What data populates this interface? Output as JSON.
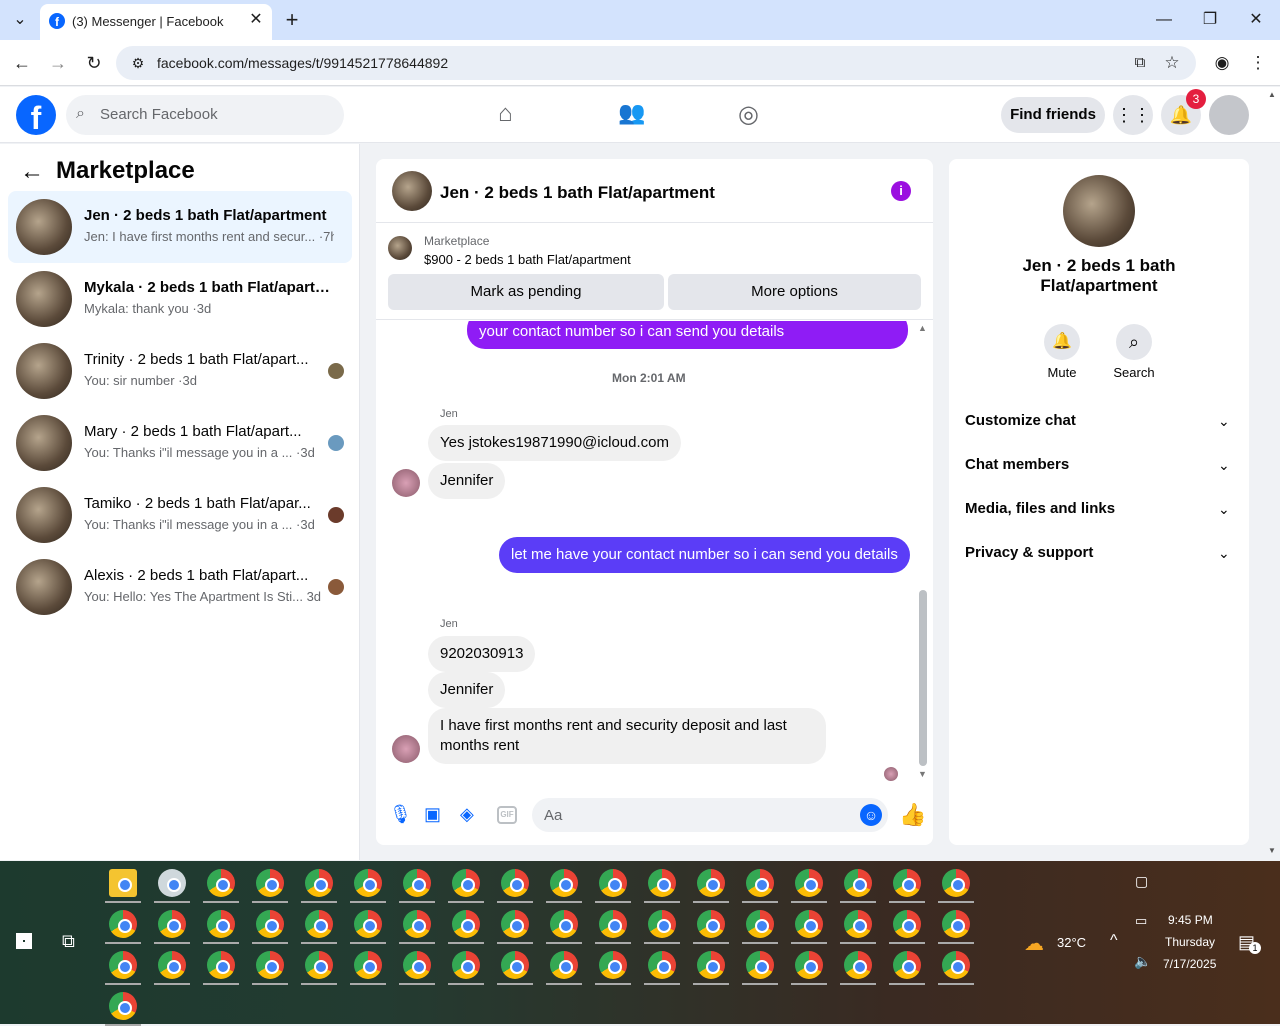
{
  "browser": {
    "tab_title": "(3) Messenger | Facebook",
    "url": "facebook.com/messages/t/9914521778644892",
    "icons": [
      "tab-search-icon",
      "facebook-favicon",
      "close-tab-icon",
      "new-tab-icon",
      "minimize-icon",
      "restore-icon",
      "close-window-icon",
      "back-icon",
      "forward-icon",
      "reload-icon",
      "site-info-icon",
      "install-app-icon",
      "bookmark-star-icon",
      "profile-icon",
      "menu-kebab-icon"
    ]
  },
  "fb_header": {
    "logo": "f",
    "search_placeholder": "Search Facebook",
    "find_friends": "Find friends",
    "notification_count": "3"
  },
  "sidebar": {
    "title": "Marketplace",
    "conversations": [
      {
        "title": "Jen · 2 beds 1 bath Flat/apartment",
        "preview": "Jen: I have first months rent and secur... ·7h",
        "active": true
      },
      {
        "title": "Mykala · 2 beds 1 bath Flat/apartm...",
        "preview": "Mykala: thank you ·3d",
        "active": false
      },
      {
        "title": "Trinity · 2 beds 1 bath Flat/apart...",
        "preview": "You: sir number ·3d",
        "active": false
      },
      {
        "title": "Mary · 2 beds 1 bath Flat/apart...",
        "preview": "You: Thanks i\"il message you in a ...  ·3d",
        "active": false
      },
      {
        "title": "Tamiko · 2 beds 1 bath Flat/apar...",
        "preview": "You: Thanks i\"il message you in a ...  ·3d",
        "active": false
      },
      {
        "title": "Alexis · 2 beds 1 bath Flat/apart...",
        "preview": "You: Hello: Yes The Apartment Is Sti...  3d",
        "active": false
      }
    ]
  },
  "chat": {
    "title": "Jen · 2 beds 1 bath Flat/apartment",
    "marketplace_label": "Marketplace",
    "listing": "$900 - 2 beds 1 bath Flat/apartment",
    "mark_pending": "Mark as pending",
    "more_options": "More options",
    "top_out_partial": "your contact number so i can send you details",
    "timestamp": "Mon 2:01 AM",
    "sender1": "Jen",
    "msg_email": "Yes jstokes19871990@icloud.com",
    "msg_jennifer1": "Jennifer",
    "msg_out": "let me have your contact number so i can send you details",
    "sender2": "Jen",
    "msg_phone": "9202030913",
    "msg_jennifer2": "Jennifer",
    "msg_last": "I have first months rent and security deposit and last months rent",
    "composer_placeholder": "Aa"
  },
  "right_panel": {
    "name_line1": "Jen · 2 beds 1 bath",
    "name_line2": "Flat/apartment",
    "mute": "Mute",
    "search": "Search",
    "sections": [
      "Customize chat",
      "Chat members",
      "Media, files and links",
      "Privacy & support"
    ]
  },
  "taskbar": {
    "temperature": "32°C",
    "time": "9:45 PM",
    "day": "Thursday",
    "date": "7/17/2025",
    "notification_count": "1"
  },
  "colors": {
    "fb_blue": "#0866ff",
    "outgoing_bubble": "#5b3df7",
    "info_purple": "#9b0fe0"
  }
}
